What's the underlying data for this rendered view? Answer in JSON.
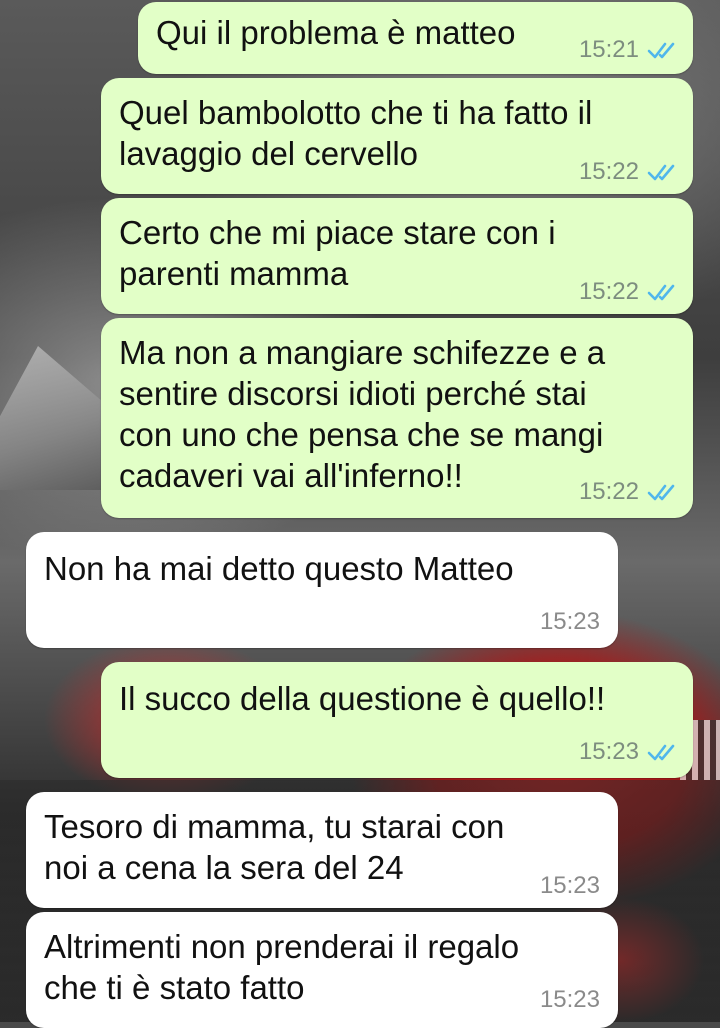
{
  "colors": {
    "outgoing_bubble": "#e2ffc7",
    "incoming_bubble": "#ffffff",
    "read_ticks": "#4fb6ec"
  },
  "messages": [
    {
      "direction": "out",
      "lines": [
        "Qui il problema è matteo"
      ],
      "time": "15:21",
      "status_icon": "double-check-read-icon"
    },
    {
      "direction": "out",
      "lines": [
        "Quel bambolotto che ti ha fatto il",
        "lavaggio del cervello"
      ],
      "time": "15:22",
      "status_icon": "double-check-read-icon"
    },
    {
      "direction": "out",
      "lines": [
        "Certo che mi piace stare con i",
        "parenti mamma"
      ],
      "time": "15:22",
      "status_icon": "double-check-read-icon"
    },
    {
      "direction": "out",
      "lines": [
        "Ma non a mangiare schifezze e a",
        "sentire discorsi idioti perché stai",
        "con uno che pensa che se mangi",
        "cadaveri vai all'inferno!!"
      ],
      "time": "15:22",
      "status_icon": "double-check-read-icon"
    },
    {
      "direction": "in",
      "lines": [
        "Non ha mai detto questo Matteo"
      ],
      "time": "15:23"
    },
    {
      "direction": "out",
      "lines": [
        "Il succo della questione è quello!!"
      ],
      "time": "15:23",
      "status_icon": "double-check-read-icon"
    },
    {
      "direction": "in",
      "lines": [
        "Tesoro di mamma, tu starai con",
        "noi a cena la sera del 24"
      ],
      "time": "15:23"
    },
    {
      "direction": "in",
      "lines": [
        "Altrimenti non prenderai il regalo",
        "che ti è stato fatto"
      ],
      "time": "15:23"
    }
  ]
}
